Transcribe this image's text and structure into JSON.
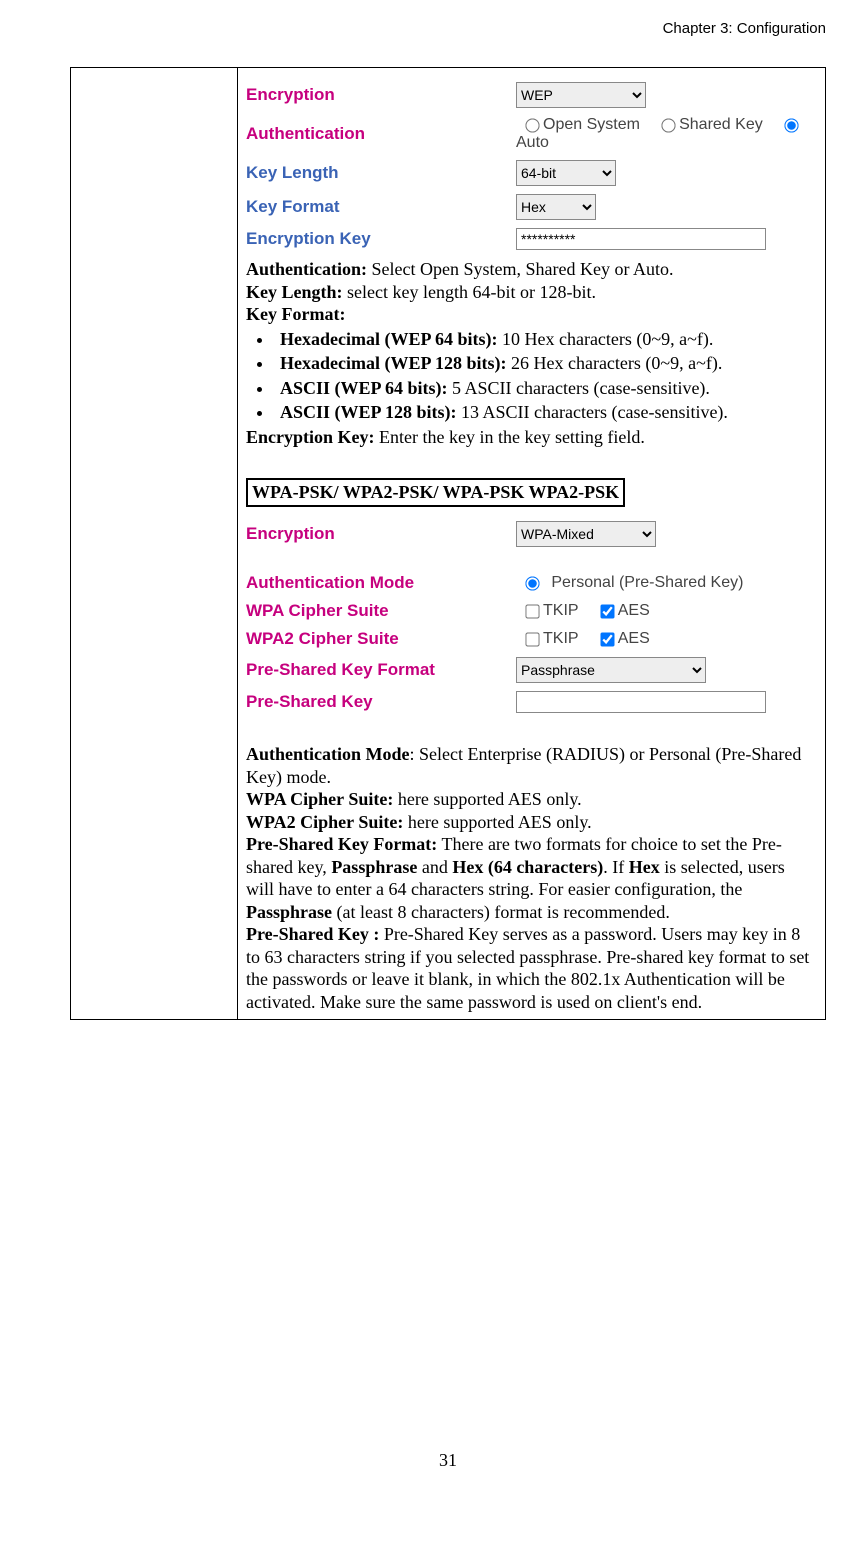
{
  "header": {
    "chapter": "Chapter 3: Configuration"
  },
  "wep": {
    "labels": {
      "encryption": "Encryption",
      "authentication": "Authentication",
      "key_length": "Key Length",
      "key_format": "Key Format",
      "encryption_key": "Encryption Key"
    },
    "encryption_value": "WEP",
    "auth_open": "Open System",
    "auth_shared": "Shared Key",
    "auth_auto": "Auto",
    "key_length_value": "64-bit",
    "key_format_value": "Hex",
    "encryption_key_value": "**********"
  },
  "wep_desc": {
    "auth_label": "Authentication:",
    "auth_text": " Select Open System, Shared Key or Auto.",
    "keylen_label": "Key Length:",
    "keylen_text": " select key length 64-bit or 128-bit.",
    "keyfmt_label": "Key Format:",
    "b1_label": "Hexadecimal (WEP 64 bits):",
    "b1_text": " 10 Hex characters (0~9, a~f).",
    "b2_label": "Hexadecimal (WEP 128 bits):",
    "b2_text": " 26 Hex characters (0~9, a~f).",
    "b3_label": "ASCII (WEP 64 bits):",
    "b3_text": " 5 ASCII characters (case-sensitive).",
    "b4_label": "ASCII (WEP 128 bits):",
    "b4_text": " 13 ASCII characters (case-sensitive).",
    "enckey_label": "Encryption Key:",
    "enckey_text": " Enter the key in the key setting field."
  },
  "wpa_heading": "WPA-PSK/ WPA2-PSK/ WPA-PSK WPA2-PSK",
  "wpa": {
    "labels": {
      "encryption": "Encryption",
      "auth_mode": "Authentication Mode",
      "wpa_cipher": "WPA Cipher Suite",
      "wpa2_cipher": "WPA2 Cipher Suite",
      "psk_format": "Pre-Shared Key Format",
      "psk": "Pre-Shared Key"
    },
    "encryption_value": "WPA-Mixed",
    "auth_personal": "Personal (Pre-Shared Key)",
    "tkip": "TKIP",
    "aes": "AES",
    "psk_format_value": "Passphrase",
    "psk_value": ""
  },
  "wpa_desc": {
    "auth_label": "Authentication Mode",
    "auth_text": ": Select Enterprise (RADIUS) or Personal (Pre-Shared Key) mode.",
    "wpa_cs_label": "WPA Cipher Suite:",
    "wpa_cs_text": " here supported AES only.",
    "wpa2_cs_label": "WPA2 Cipher Suite:",
    "wpa2_cs_text": " here supported AES only.",
    "pskf_label": "Pre-Shared Key Format:",
    "pskf_t1": "  There are two formats for choice to set the Pre-shared key, ",
    "pskf_b1": "Passphrase",
    "pskf_t2": " and ",
    "pskf_b2": "Hex (64 characters)",
    "pskf_t3": ". If ",
    "pskf_b3": "Hex",
    "pskf_t4": " is selected, users will have to enter a 64 characters string. For easier configuration, the ",
    "pskf_b4": "Passphrase",
    "pskf_t5": " (at least 8 characters) format is recommended.",
    "psk_label": "Pre-Shared Key :",
    "psk_text": " Pre-Shared Key serves as a password.  Users may key in 8 to 63 characters string if you selected passphrase. Pre-shared key format to set the passwords or leave it blank, in which the 802.1x Authentication will be activated.  Make sure the same password is used on client's end."
  },
  "page_number": "31"
}
